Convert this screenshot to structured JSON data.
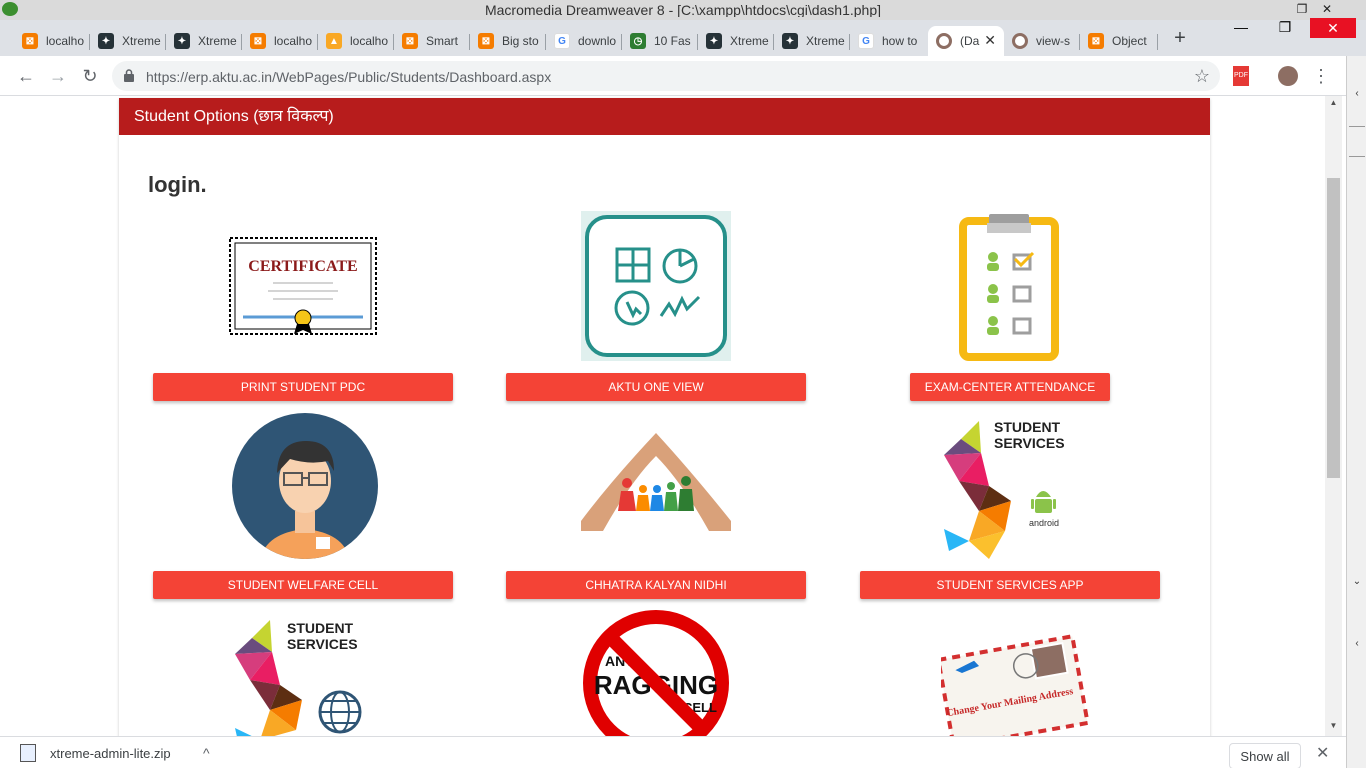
{
  "window": {
    "title": "Macromedia Dreamweaver 8 - [C:\\xampp\\htdocs\\cgi\\dash1.php]",
    "minimize_label": "—",
    "restore_label": "❐",
    "close_label": "✕"
  },
  "tabs": [
    {
      "label": "localho",
      "icon": "xampp-icon",
      "color": "#f57c00"
    },
    {
      "label": "Xtreme",
      "icon": "xtreme-icon",
      "color": "#263238"
    },
    {
      "label": "Xtreme",
      "icon": "xtreme-icon",
      "color": "#263238"
    },
    {
      "label": "localho",
      "icon": "xampp-icon",
      "color": "#f57c00"
    },
    {
      "label": "localho",
      "icon": "phpmyadmin-icon",
      "color": "#f9a825"
    },
    {
      "label": "Smart",
      "icon": "xampp-icon",
      "color": "#f57c00"
    },
    {
      "label": "Big sto",
      "icon": "xampp-icon",
      "color": "#f57c00"
    },
    {
      "label": "downlo",
      "icon": "google-icon",
      "color": "#4285f4"
    },
    {
      "label": "10 Fas",
      "icon": "timer-icon",
      "color": "#2e7d32"
    },
    {
      "label": "Xtreme",
      "icon": "xtreme-icon",
      "color": "#263238"
    },
    {
      "label": "Xtreme",
      "icon": "xtreme-icon",
      "color": "#263238"
    },
    {
      "label": "how to",
      "icon": "google-icon",
      "color": "#4285f4"
    },
    {
      "label": "(Da",
      "icon": "aktu-icon",
      "color": "#8d6e63",
      "active": true
    },
    {
      "label": "view-s",
      "icon": "aktu-icon",
      "color": "#8d6e63"
    },
    {
      "label": "Object",
      "icon": "xampp-icon",
      "color": "#f57c00"
    }
  ],
  "tab_close_label": "✕",
  "new_tab_label": "+",
  "toolbar": {
    "back_label": "←",
    "forward_label": "→",
    "reload_label": "↻",
    "url": "https://erp.aktu.ac.in/WebPages/Public/Students/Dashboard.aspx",
    "star_label": "☆",
    "pdf_label": "PDF",
    "menu_label": "⋮"
  },
  "page": {
    "header": "Student Options (छात्र विकल्प)",
    "heading": "login.",
    "tiles": [
      {
        "label": "PRINT STUDENT PDC",
        "icon": "certificate-icon",
        "certificate_text": "CERTIFICATE"
      },
      {
        "label": "AKTU ONE VIEW",
        "icon": "dashboard-icon"
      },
      {
        "label": "EXAM-CENTER ATTENDANCE",
        "icon": "attendance-clipboard-icon"
      },
      {
        "label": "STUDENT WELFARE CELL",
        "icon": "student-avatar-icon"
      },
      {
        "label": "CHHATRA KALYAN NIDHI",
        "icon": "family-hands-icon"
      },
      {
        "label": "STUDENT SERVICES APP",
        "icon": "student-services-android-icon",
        "logo_line1": "STUDENT",
        "logo_line2": "SERVICES",
        "logo_sub": "android"
      },
      {
        "icon": "student-services-web-icon",
        "logo_line1": "STUDENT",
        "logo_line2": "SERVICES"
      },
      {
        "icon": "anti-ragging-icon",
        "logo_line1": "ANTI",
        "logo_line2": "RAGGING",
        "logo_line3": "CELL"
      },
      {
        "icon": "mailing-address-icon",
        "envelope_text": "Change Your Mailing Address"
      }
    ]
  },
  "download": {
    "filename": "xtreme-admin-lite.zip",
    "chevron": "^",
    "show_all": "Show all",
    "close": "✕"
  },
  "colors": {
    "header_red": "#b71c1c",
    "button_red": "#f44336",
    "tab_strip": "#dee1e6"
  }
}
